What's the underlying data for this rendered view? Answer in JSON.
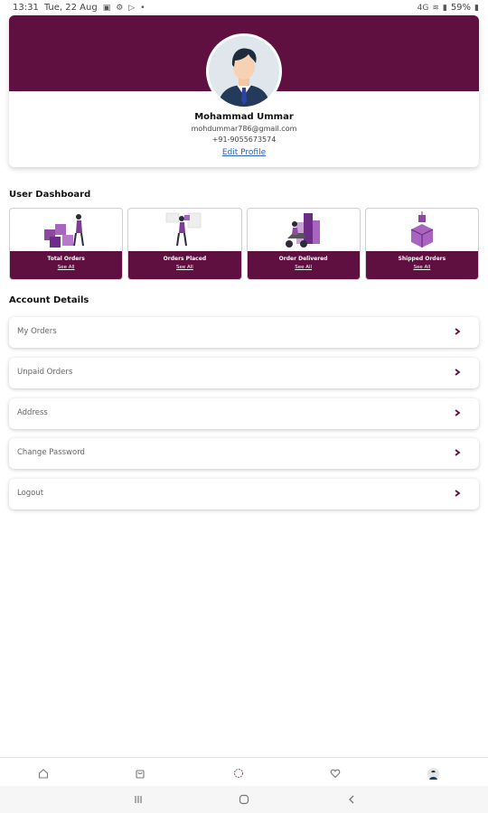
{
  "status_bar": {
    "time": "13:31",
    "date": "Tue, 22 Aug",
    "battery": "59%",
    "signal_text": "4G"
  },
  "profile": {
    "name": "Mohammad Ummar",
    "email": "mohdummar786@gmail.com",
    "phone": "+91-9055673574",
    "edit_label": "Edit Profile"
  },
  "dashboard": {
    "title": "User Dashboard",
    "tiles": [
      {
        "label": "Total Orders",
        "link": "See All"
      },
      {
        "label": "Orders Placed",
        "link": "See All"
      },
      {
        "label": "Order Delivered",
        "link": "See All"
      },
      {
        "label": "Shipped Orders",
        "link": "See All"
      }
    ]
  },
  "account": {
    "title": "Account Details",
    "items": [
      {
        "label": "My Orders"
      },
      {
        "label": "Unpaid Orders"
      },
      {
        "label": "Address"
      },
      {
        "label": "Change Password"
      },
      {
        "label": "Logout"
      }
    ]
  },
  "colors": {
    "brand": "#5f0f40",
    "link": "#2b62b8"
  },
  "bottom_nav": [
    "home-icon",
    "shopping-bag-icon",
    "categories-icon",
    "heart-icon",
    "profile-avatar-icon"
  ],
  "system_nav": [
    "recent-apps-icon",
    "home-circle-icon",
    "back-icon"
  ]
}
